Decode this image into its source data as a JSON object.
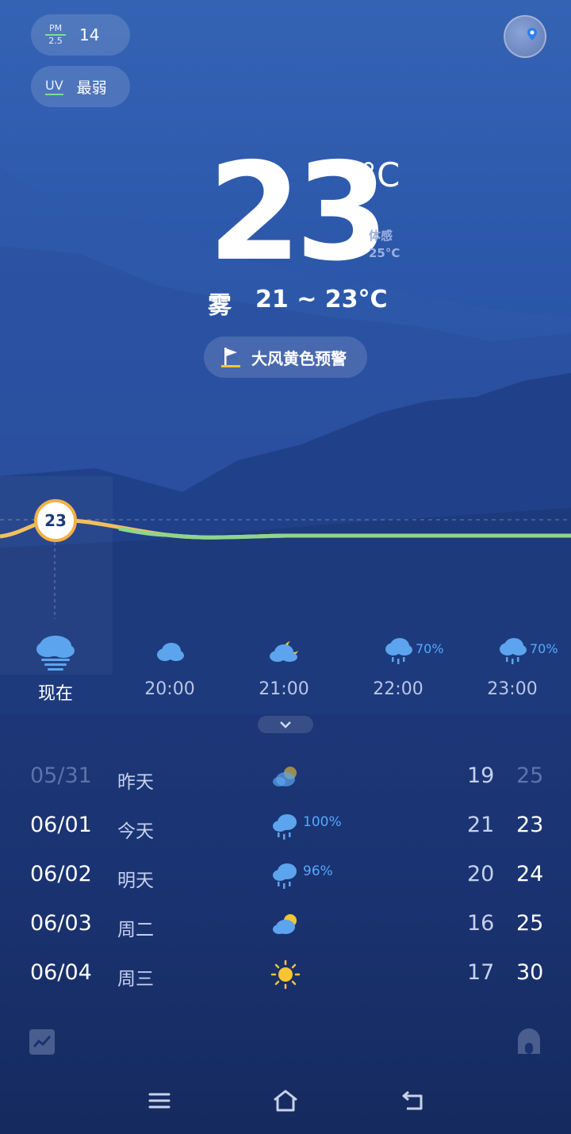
{
  "aqi": {
    "label_top": "PM",
    "label_bottom": "2.5",
    "value": "14"
  },
  "uv": {
    "label": "UV",
    "value": "最弱"
  },
  "current": {
    "temp": "23",
    "unit": "°C",
    "feels_label": "体感",
    "feels_value": "25°C",
    "condition": "雾",
    "range": "21 ~ 23°C"
  },
  "alert": {
    "text": "大风黄色预警",
    "icon": "flag-icon"
  },
  "curve": {
    "marker_value": "23"
  },
  "hourly": [
    {
      "label": "现在",
      "icon": "fog-cloud-icon",
      "pct": ""
    },
    {
      "label": "20:00",
      "icon": "cloud-icon",
      "pct": ""
    },
    {
      "label": "21:00",
      "icon": "cloud-moon-icon",
      "pct": ""
    },
    {
      "label": "22:00",
      "icon": "rain-cloud-icon",
      "pct": "70%"
    },
    {
      "label": "23:00",
      "icon": "rain-cloud-icon",
      "pct": "70%"
    }
  ],
  "daily": [
    {
      "date": "05/31",
      "day": "昨天",
      "icon": "cloud-sun-icon",
      "pct": "",
      "low": "19",
      "high": "25"
    },
    {
      "date": "06/01",
      "day": "今天",
      "icon": "rain-cloud-icon",
      "pct": "100%",
      "low": "21",
      "high": "23"
    },
    {
      "date": "06/02",
      "day": "明天",
      "icon": "rain-cloud-icon",
      "pct": "96%",
      "low": "20",
      "high": "24"
    },
    {
      "date": "06/03",
      "day": "周二",
      "icon": "cloud-sun-icon",
      "pct": "",
      "low": "16",
      "high": "25"
    },
    {
      "date": "06/04",
      "day": "周三",
      "icon": "sun-icon",
      "pct": "",
      "low": "17",
      "high": "30"
    }
  ],
  "colors": {
    "accent_green": "#7be08c",
    "rain_blue": "#56a8ff",
    "marker_orange": "#f2b04a",
    "sun_yellow": "#f7c531"
  }
}
